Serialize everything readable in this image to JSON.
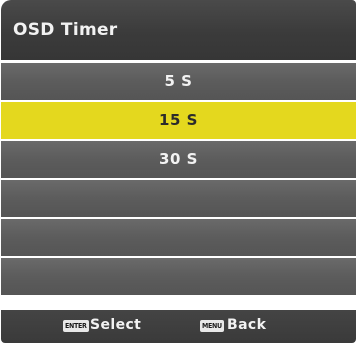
{
  "header": {
    "title": "OSD Timer"
  },
  "menu": {
    "items": [
      {
        "label": "5 S",
        "selected": false
      },
      {
        "label": "15 S",
        "selected": true
      },
      {
        "label": "30 S",
        "selected": false
      },
      {
        "label": "",
        "selected": false
      },
      {
        "label": "",
        "selected": false
      },
      {
        "label": "",
        "selected": false
      }
    ]
  },
  "footer": {
    "select_key": "ENTER",
    "select_label": "Select",
    "back_key": "MENU",
    "back_label": "Back"
  },
  "colors": {
    "highlight": "#e4d81e",
    "row": "#5c5c5c",
    "header": "#3b3b3b"
  }
}
